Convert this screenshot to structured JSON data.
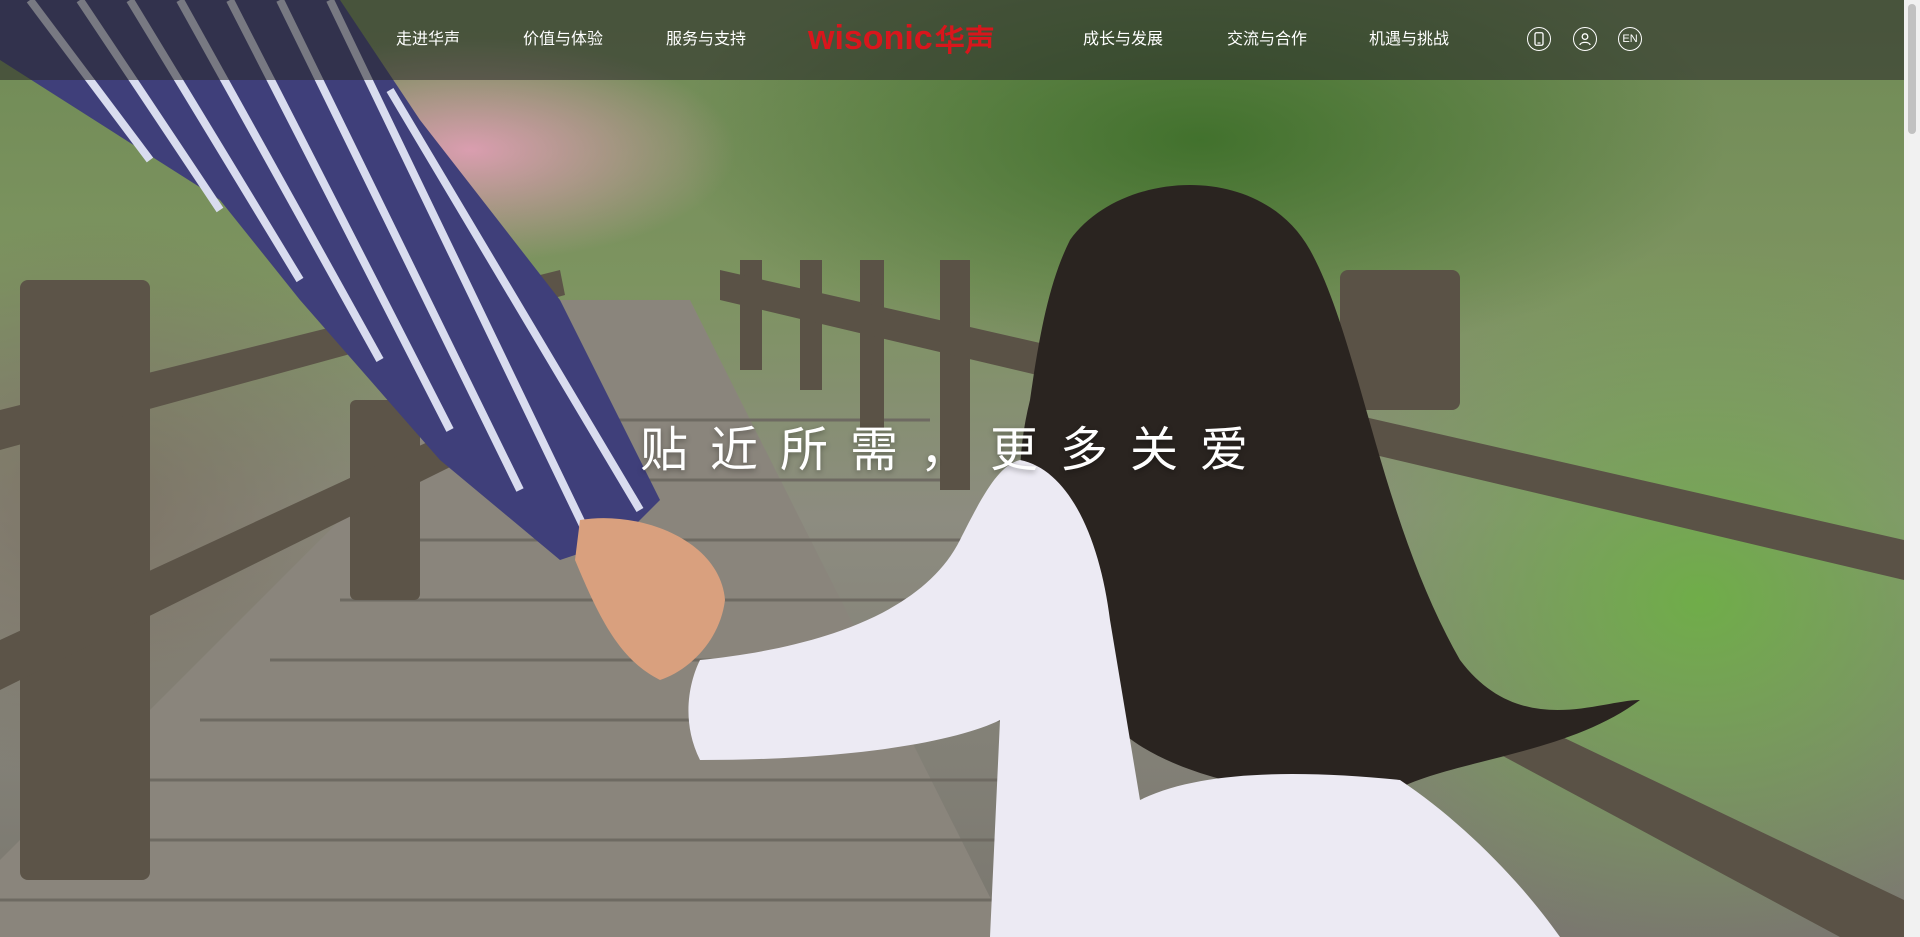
{
  "nav": {
    "left": [
      {
        "label": "走进华声"
      },
      {
        "label": "价值与体验"
      },
      {
        "label": "服务与支持"
      }
    ],
    "right": [
      {
        "label": "成长与发展"
      },
      {
        "label": "交流与合作"
      },
      {
        "label": "机遇与挑战"
      }
    ]
  },
  "logo": {
    "latin": "wisonic",
    "cn": "华声",
    "color": "#d9161c"
  },
  "toolbar": {
    "mobile_icon": "mobile-phone-icon",
    "user_icon": "user-icon",
    "language_label": "EN"
  },
  "hero": {
    "headline": "贴近所需，更多关爱"
  }
}
